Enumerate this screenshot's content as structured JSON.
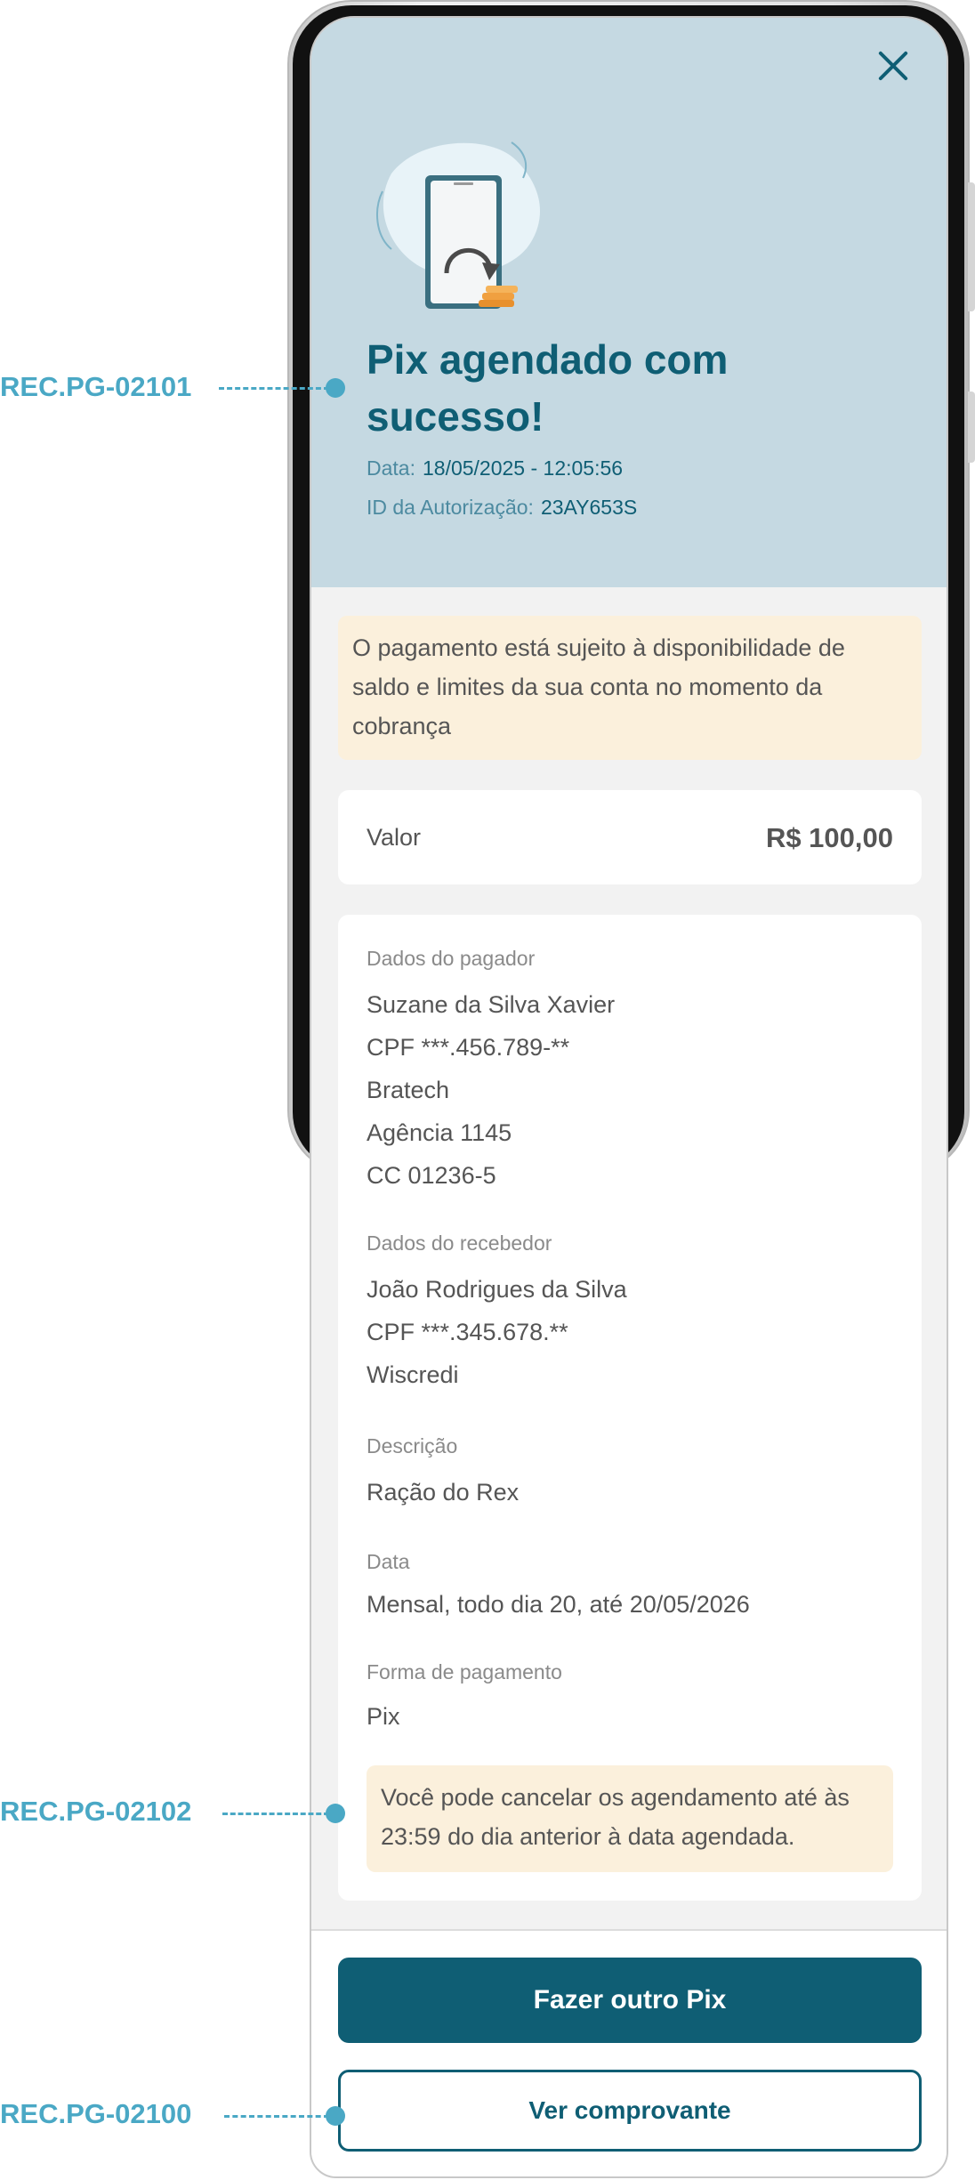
{
  "header": {
    "title": "Pix agendado com sucesso!",
    "date_label": "Data:",
    "date_value": "18/05/2025 - 12:05:56",
    "auth_label": "ID da Autorização:",
    "auth_value": "23AY653S",
    "close_icon": "close-icon"
  },
  "notice": "O pagamento está sujeito à disponibilidade de saldo e limites da sua conta no momento da cobrança",
  "value": {
    "label": "Valor",
    "amount": "R$ 100,00"
  },
  "payer": {
    "label": "Dados do pagador",
    "lines": [
      "Suzane da Silva Xavier",
      "CPF ***.456.789-**",
      "Bratech",
      "Agência 1145",
      "CC 01236-5"
    ]
  },
  "receiver": {
    "label": "Dados do recebedor",
    "lines": [
      "João Rodrigues da Silva",
      "CPF ***.345.678.**",
      "Wiscredi"
    ]
  },
  "description": {
    "label": "Descrição",
    "value": "Ração do Rex"
  },
  "date": {
    "label": "Data",
    "value": "Mensal, todo dia 20, até 20/05/2026"
  },
  "payment": {
    "label": "Forma de pagamento",
    "value": "Pix"
  },
  "cancel_notice": "Você pode cancelar os agendamento até às 23:59 do dia anterior à data agendada.",
  "buttons": {
    "primary": "Fazer outro Pix",
    "secondary": "Ver comprovante"
  },
  "annotations": [
    "REC.PG-02101",
    "REC.PG-02102",
    "REC.PG-02100"
  ],
  "colors": {
    "accent": "#0f5e74",
    "header_bg": "#c5d9e2",
    "notice_bg": "#fbf0dc",
    "annotation": "#4aa8c5"
  }
}
